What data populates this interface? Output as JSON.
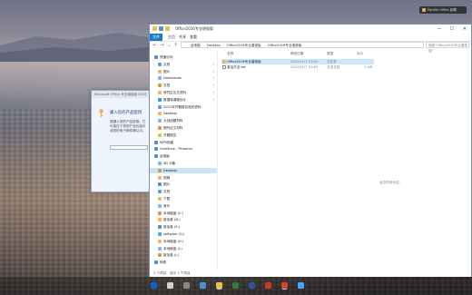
{
  "notification": {
    "text": "Pantile Office 卸载"
  },
  "setup_dialog": {
    "title": "Microsoft Office 专业增强版 2016",
    "heading": "输入您的产品密钥",
    "description": "请键入您的产品密钥。它可能位于您的产品包装中或您的电子邮件确认中。",
    "key_value": ""
  },
  "explorer": {
    "title": "Office2016专业增强版",
    "ribbon_tabs": [
      "文件",
      "主页",
      "共享",
      "查看"
    ],
    "window_controls": [
      "—",
      "☐",
      "✕"
    ],
    "address": [
      "此电脑",
      "Desktop",
      "Office2016专业增强版",
      "Office2016专业增强版"
    ],
    "search_placeholder": "搜索\"Office2016专业增强版\"",
    "nav_items": [
      {
        "label": "快速访问",
        "group": true,
        "pin": false
      },
      {
        "label": "文档",
        "group": false,
        "pin": true
      },
      {
        "label": "图片",
        "group": false,
        "pin": true
      },
      {
        "label": "Downloads",
        "group": false,
        "pin": true
      },
      {
        "label": "文档",
        "group": false,
        "pin": true
      },
      {
        "label": "研究生论文资料",
        "group": false,
        "pin": true
      },
      {
        "label": "数据库课程设计",
        "group": false,
        "pin": true
      },
      {
        "label": "2021年开题报告相关资料",
        "group": false,
        "pin": false
      },
      {
        "label": "Desktop",
        "group": false,
        "pin": false
      },
      {
        "label": "大创结题材料",
        "group": false,
        "pin": false
      },
      {
        "label": "期刊论文材料",
        "group": false,
        "pin": false
      },
      {
        "label": "开题报告",
        "group": false,
        "pin": false
      },
      {
        "label": "WPS网盘",
        "group": true,
        "pin": false
      },
      {
        "label": "OneDrive - Personal",
        "group": true,
        "pin": false
      },
      {
        "label": "此电脑",
        "group": true,
        "pin": false
      },
      {
        "label": "3D 对象",
        "group": false,
        "pin": false
      },
      {
        "label": "Desktop",
        "group": false,
        "pin": false,
        "selected": true
      },
      {
        "label": "视频",
        "group": false,
        "pin": false
      },
      {
        "label": "图片",
        "group": false,
        "pin": false
      },
      {
        "label": "文档",
        "group": false,
        "pin": false
      },
      {
        "label": "下载",
        "group": false,
        "pin": false
      },
      {
        "label": "音乐",
        "group": false,
        "pin": false
      },
      {
        "label": "本地磁盘 (C:)",
        "group": false,
        "pin": false
      },
      {
        "label": "新加卷 (D:)",
        "group": false,
        "pin": false
      },
      {
        "label": "新加卷 (E:)",
        "group": false,
        "pin": false
      },
      {
        "label": "software (G:)",
        "group": false,
        "pin": false
      },
      {
        "label": "本地磁盘 (H:)",
        "group": false,
        "pin": false
      },
      {
        "label": "本地磁盘 (I:)",
        "group": false,
        "pin": false
      },
      {
        "label": "新加卷 (J:)",
        "group": false,
        "pin": false
      },
      {
        "label": "网络",
        "group": true,
        "pin": false
      }
    ],
    "columns": {
      "name": "名称",
      "date": "修改日期",
      "type": "类型",
      "size": "大小"
    },
    "files": [
      {
        "name": "Office2016专业增强版",
        "date": "2022/11/7 21:43",
        "type": "文件夹",
        "size": "",
        "selected": true
      },
      {
        "name": "激活方法.txt",
        "date": "2022/11/7 21:43",
        "type": "文本文档",
        "size": "1 KB",
        "selected": false
      }
    ],
    "empty_hint": "此文件夹为空。",
    "status_count": "2 个项目",
    "status_selected": "选中 1 个项目"
  }
}
